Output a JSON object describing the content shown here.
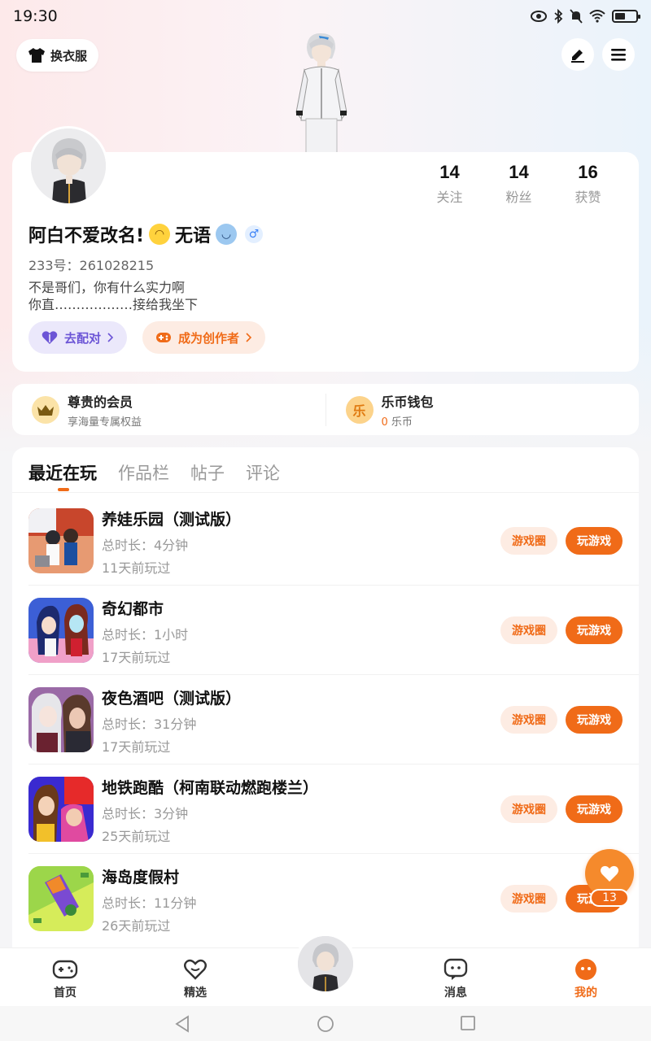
{
  "status_bar": {
    "time": "19:30"
  },
  "header": {
    "dress_label": "换衣服"
  },
  "profile": {
    "stats": [
      {
        "num": "14",
        "label": "关注"
      },
      {
        "num": "14",
        "label": "粉丝"
      },
      {
        "num": "16",
        "label": "获赞"
      }
    ],
    "nickname_a": "阿白不爱改名!",
    "nickname_b": "无语",
    "uid": "233号：261028215",
    "bio_line1": "不是哥们，你有什么实力啊",
    "bio_line2": "你直………………接给我坐下",
    "match_label": "去配对",
    "creator_label": "成为创作者"
  },
  "member": {
    "title": "尊贵的会员",
    "sub": "享海量专属权益"
  },
  "wallet": {
    "title": "乐币钱包",
    "icon_char": "乐",
    "amount": "0",
    "unit": "乐币"
  },
  "tabs": [
    "最近在玩",
    "作品栏",
    "帖子",
    "评论"
  ],
  "game_buttons": {
    "circle": "游戏圈",
    "play": "玩游戏"
  },
  "games": [
    {
      "name": "养娃乐园（测试版）",
      "duration": "总时长：4分钟",
      "last": "11天前玩过"
    },
    {
      "name": "奇幻都市",
      "duration": "总时长：1小时",
      "last": "17天前玩过"
    },
    {
      "name": "夜色酒吧（测试版）",
      "duration": "总时长：31分钟",
      "last": "17天前玩过"
    },
    {
      "name": "地铁跑酷（柯南联动燃跑楼兰）",
      "duration": "总时长：3分钟",
      "last": "25天前玩过"
    },
    {
      "name": "海岛度假村",
      "duration": "总时长：11分钟",
      "last": "26天前玩过"
    }
  ],
  "like": {
    "count": "13"
  },
  "bottom_nav": [
    {
      "label": "首页"
    },
    {
      "label": "精选"
    },
    {
      "label": "消息"
    },
    {
      "label": "我的"
    }
  ],
  "colors": {
    "accent": "#f06b18",
    "match": "#6c55d6"
  }
}
